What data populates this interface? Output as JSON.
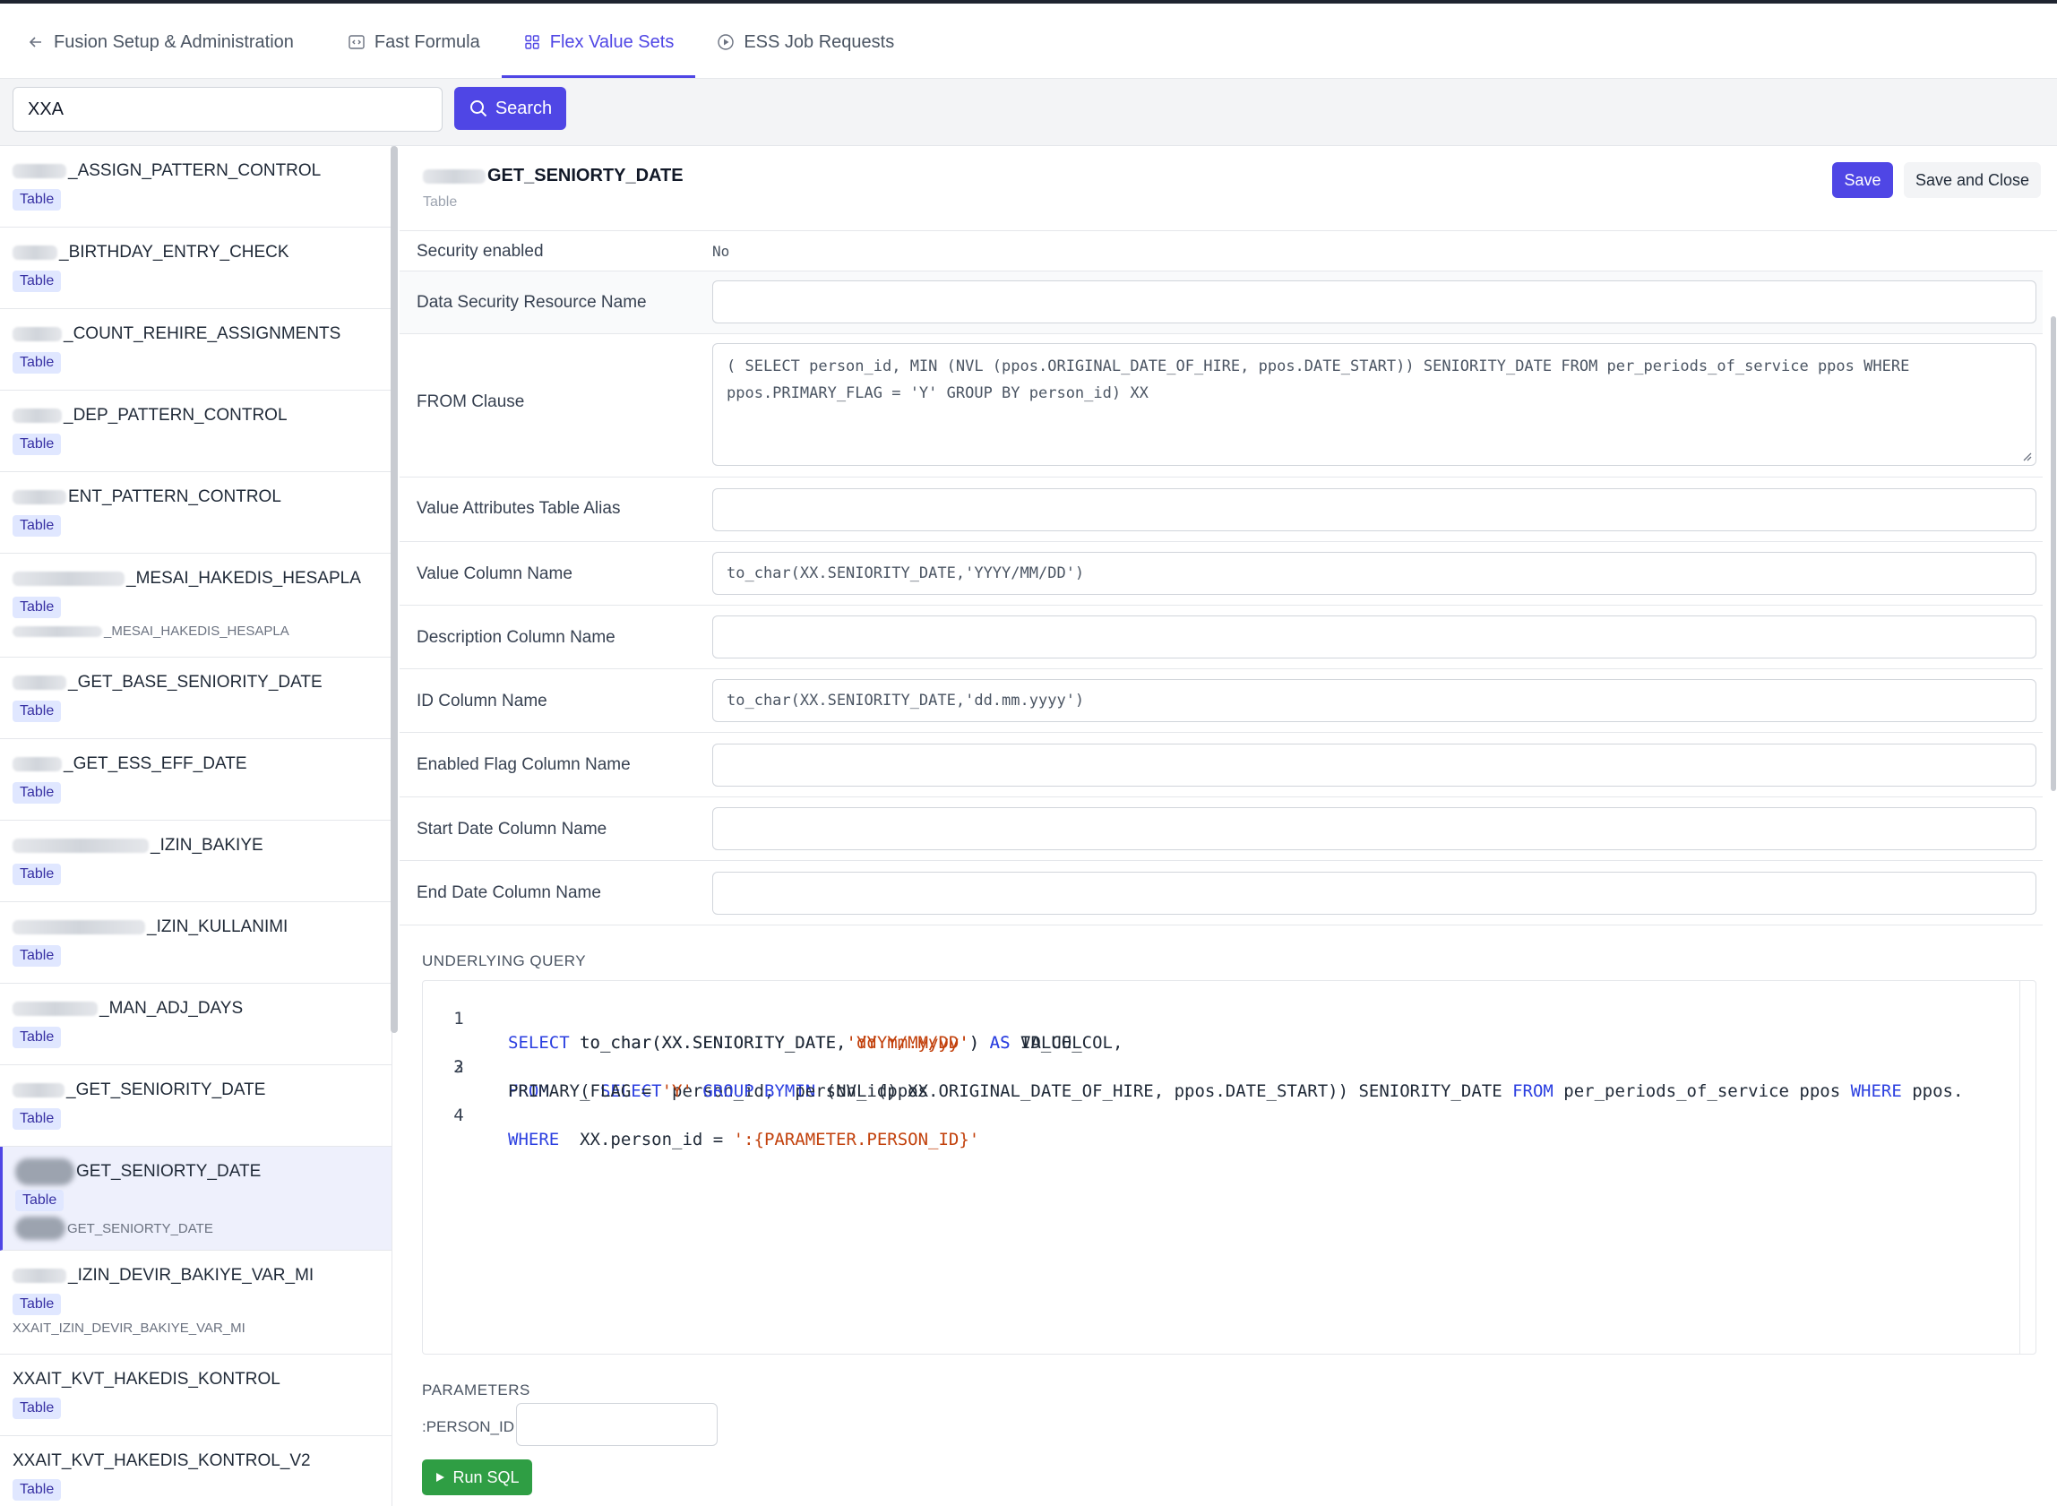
{
  "nav": {
    "back_label": "Fusion Setup & Administration",
    "tabs": [
      {
        "label": "Fast Formula",
        "icon": "code-icon"
      },
      {
        "label": "Flex Value Sets",
        "icon": "grid-icon",
        "active": true
      },
      {
        "label": "ESS Job Requests",
        "icon": "play-circle-icon"
      }
    ]
  },
  "search": {
    "value": "XXA",
    "button_label": "Search"
  },
  "sidebar": {
    "items": [
      {
        "name": "_ASSIGN_PATTERN_CONTROL",
        "type": "Table",
        "desc": ""
      },
      {
        "name": "_BIRTHDAY_ENTRY_CHECK",
        "type": "Table",
        "desc": ""
      },
      {
        "name": "_COUNT_REHIRE_ASSIGNMENTS",
        "type": "Table",
        "desc": ""
      },
      {
        "name": "_DEP_PATTERN_CONTROL",
        "type": "Table",
        "desc": ""
      },
      {
        "name": "ENT_PATTERN_CONTROL",
        "type": "Table",
        "desc": ""
      },
      {
        "name": "_MESAI_HAKEDIS_HESAPLA",
        "type": "Table",
        "desc": "_MESAI_HAKEDIS_HESAPLA"
      },
      {
        "name": "_GET_BASE_SENIORITY_DATE",
        "type": "Table",
        "desc": ""
      },
      {
        "name": "_GET_ESS_EFF_DATE",
        "type": "Table",
        "desc": ""
      },
      {
        "name": "_IZIN_BAKIYE",
        "type": "Table",
        "desc": ""
      },
      {
        "name": "_IZIN_KULLANIMI",
        "type": "Table",
        "desc": ""
      },
      {
        "name": "_MAN_ADJ_DAYS",
        "type": "Table",
        "desc": ""
      },
      {
        "name": "_GET_SENIORITY_DATE",
        "type": "Table",
        "desc": ""
      },
      {
        "name": "GET_SENIORTY_DATE",
        "type": "Table",
        "desc": "GET_SENIORTY_DATE",
        "selected": true
      },
      {
        "name": "_IZIN_DEVIR_BAKIYE_VAR_MI",
        "type": "Table",
        "desc": "XXAIT_IZIN_DEVIR_BAKIYE_VAR_MI"
      },
      {
        "name": "XXAIT_KVT_HAKEDIS_KONTROL",
        "type": "Table",
        "desc": ""
      },
      {
        "name": "XXAIT_KVT_HAKEDIS_KONTROL_V2",
        "type": "Table",
        "desc": ""
      }
    ]
  },
  "detail": {
    "title": "GET_SENIORTY_DATE",
    "subtitle": "Table",
    "save_label": "Save",
    "save_close_label": "Save and Close",
    "fields": {
      "security_enabled": {
        "label": "Security enabled",
        "value": "No"
      },
      "data_security_resource": {
        "label": "Data Security Resource Name",
        "value": ""
      },
      "from_clause": {
        "label": "FROM Clause",
        "value": "( SELECT person_id, MIN (NVL (ppos.ORIGINAL_DATE_OF_HIRE, ppos.DATE_START)) SENIORITY_DATE FROM per_periods_of_service ppos WHERE ppos.PRIMARY_FLAG = 'Y' GROUP BY person_id) XX"
      },
      "value_attr_alias": {
        "label": "Value Attributes Table Alias",
        "value": ""
      },
      "value_column": {
        "label": "Value Column Name",
        "value": "to_char(XX.SENIORITY_DATE,'YYYY/MM/DD')"
      },
      "desc_column": {
        "label": "Description Column Name",
        "value": ""
      },
      "id_column": {
        "label": "ID Column Name",
        "value": "to_char(XX.SENIORITY_DATE,'dd.mm.yyyy')"
      },
      "enabled_flag_column": {
        "label": "Enabled Flag Column Name",
        "value": ""
      },
      "start_date_column": {
        "label": "Start Date Column Name",
        "value": ""
      },
      "end_date_column": {
        "label": "End Date Column Name",
        "value": ""
      }
    },
    "query_label": "UNDERLYING QUERY",
    "line_numbers": [
      "1",
      "2",
      "3",
      "4"
    ],
    "params_label": "PARAMETERS",
    "param_name": ":PERSON_ID",
    "param_value": "",
    "run_label": "Run SQL"
  },
  "colors": {
    "accent": "#4f46e5",
    "run": "#2f9e44",
    "keyword": "#2b3fe0",
    "string": "#c2410c"
  }
}
